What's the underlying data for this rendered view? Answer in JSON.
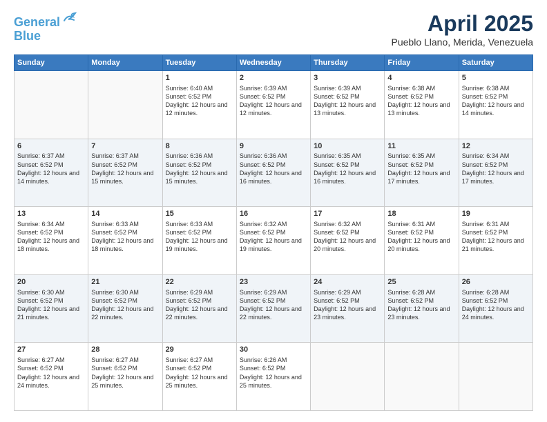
{
  "header": {
    "logo_line1": "General",
    "logo_line2": "Blue",
    "title": "April 2025",
    "subtitle": "Pueblo Llano, Merida, Venezuela"
  },
  "weekdays": [
    "Sunday",
    "Monday",
    "Tuesday",
    "Wednesday",
    "Thursday",
    "Friday",
    "Saturday"
  ],
  "weeks": [
    [
      {
        "day": "",
        "info": ""
      },
      {
        "day": "",
        "info": ""
      },
      {
        "day": "1",
        "info": "Sunrise: 6:40 AM\nSunset: 6:52 PM\nDaylight: 12 hours and 12 minutes."
      },
      {
        "day": "2",
        "info": "Sunrise: 6:39 AM\nSunset: 6:52 PM\nDaylight: 12 hours and 12 minutes."
      },
      {
        "day": "3",
        "info": "Sunrise: 6:39 AM\nSunset: 6:52 PM\nDaylight: 12 hours and 13 minutes."
      },
      {
        "day": "4",
        "info": "Sunrise: 6:38 AM\nSunset: 6:52 PM\nDaylight: 12 hours and 13 minutes."
      },
      {
        "day": "5",
        "info": "Sunrise: 6:38 AM\nSunset: 6:52 PM\nDaylight: 12 hours and 14 minutes."
      }
    ],
    [
      {
        "day": "6",
        "info": "Sunrise: 6:37 AM\nSunset: 6:52 PM\nDaylight: 12 hours and 14 minutes."
      },
      {
        "day": "7",
        "info": "Sunrise: 6:37 AM\nSunset: 6:52 PM\nDaylight: 12 hours and 15 minutes."
      },
      {
        "day": "8",
        "info": "Sunrise: 6:36 AM\nSunset: 6:52 PM\nDaylight: 12 hours and 15 minutes."
      },
      {
        "day": "9",
        "info": "Sunrise: 6:36 AM\nSunset: 6:52 PM\nDaylight: 12 hours and 16 minutes."
      },
      {
        "day": "10",
        "info": "Sunrise: 6:35 AM\nSunset: 6:52 PM\nDaylight: 12 hours and 16 minutes."
      },
      {
        "day": "11",
        "info": "Sunrise: 6:35 AM\nSunset: 6:52 PM\nDaylight: 12 hours and 17 minutes."
      },
      {
        "day": "12",
        "info": "Sunrise: 6:34 AM\nSunset: 6:52 PM\nDaylight: 12 hours and 17 minutes."
      }
    ],
    [
      {
        "day": "13",
        "info": "Sunrise: 6:34 AM\nSunset: 6:52 PM\nDaylight: 12 hours and 18 minutes."
      },
      {
        "day": "14",
        "info": "Sunrise: 6:33 AM\nSunset: 6:52 PM\nDaylight: 12 hours and 18 minutes."
      },
      {
        "day": "15",
        "info": "Sunrise: 6:33 AM\nSunset: 6:52 PM\nDaylight: 12 hours and 19 minutes."
      },
      {
        "day": "16",
        "info": "Sunrise: 6:32 AM\nSunset: 6:52 PM\nDaylight: 12 hours and 19 minutes."
      },
      {
        "day": "17",
        "info": "Sunrise: 6:32 AM\nSunset: 6:52 PM\nDaylight: 12 hours and 20 minutes."
      },
      {
        "day": "18",
        "info": "Sunrise: 6:31 AM\nSunset: 6:52 PM\nDaylight: 12 hours and 20 minutes."
      },
      {
        "day": "19",
        "info": "Sunrise: 6:31 AM\nSunset: 6:52 PM\nDaylight: 12 hours and 21 minutes."
      }
    ],
    [
      {
        "day": "20",
        "info": "Sunrise: 6:30 AM\nSunset: 6:52 PM\nDaylight: 12 hours and 21 minutes."
      },
      {
        "day": "21",
        "info": "Sunrise: 6:30 AM\nSunset: 6:52 PM\nDaylight: 12 hours and 22 minutes."
      },
      {
        "day": "22",
        "info": "Sunrise: 6:29 AM\nSunset: 6:52 PM\nDaylight: 12 hours and 22 minutes."
      },
      {
        "day": "23",
        "info": "Sunrise: 6:29 AM\nSunset: 6:52 PM\nDaylight: 12 hours and 22 minutes."
      },
      {
        "day": "24",
        "info": "Sunrise: 6:29 AM\nSunset: 6:52 PM\nDaylight: 12 hours and 23 minutes."
      },
      {
        "day": "25",
        "info": "Sunrise: 6:28 AM\nSunset: 6:52 PM\nDaylight: 12 hours and 23 minutes."
      },
      {
        "day": "26",
        "info": "Sunrise: 6:28 AM\nSunset: 6:52 PM\nDaylight: 12 hours and 24 minutes."
      }
    ],
    [
      {
        "day": "27",
        "info": "Sunrise: 6:27 AM\nSunset: 6:52 PM\nDaylight: 12 hours and 24 minutes."
      },
      {
        "day": "28",
        "info": "Sunrise: 6:27 AM\nSunset: 6:52 PM\nDaylight: 12 hours and 25 minutes."
      },
      {
        "day": "29",
        "info": "Sunrise: 6:27 AM\nSunset: 6:52 PM\nDaylight: 12 hours and 25 minutes."
      },
      {
        "day": "30",
        "info": "Sunrise: 6:26 AM\nSunset: 6:52 PM\nDaylight: 12 hours and 25 minutes."
      },
      {
        "day": "",
        "info": ""
      },
      {
        "day": "",
        "info": ""
      },
      {
        "day": "",
        "info": ""
      }
    ]
  ]
}
